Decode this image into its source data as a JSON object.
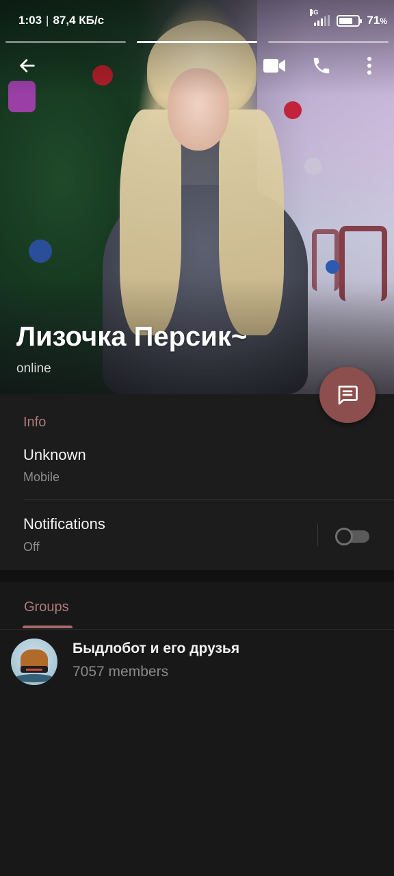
{
  "status_bar": {
    "time": "1:03",
    "separator": "|",
    "net_speed": "87,4 КБ/с",
    "network_type": "4G",
    "battery_level": 0.71,
    "battery_percent": "71",
    "battery_percent_sign": "%"
  },
  "stories": {
    "count": 3,
    "active_index": 1
  },
  "toolbar": {
    "back_icon": "arrow-left-icon",
    "video_icon": "video-camera-icon",
    "phone_icon": "phone-icon",
    "more_icon": "more-vertical-icon"
  },
  "profile": {
    "name": "Лизочка Персик~",
    "status": "online"
  },
  "fab": {
    "icon": "message-icon",
    "color": "#8d4f4d"
  },
  "info": {
    "section_title": "Info",
    "phone_value": "Unknown",
    "phone_label": "Mobile",
    "notifications_title": "Notifications",
    "notifications_value": "Off",
    "notifications_enabled": false
  },
  "groups": {
    "tab_label": "Groups",
    "items": [
      {
        "name": "Быдлобот и его друзья",
        "members": "7057 members"
      }
    ]
  },
  "colors": {
    "accent": "#b07a7a",
    "background": "#1c1c1c",
    "fab": "#8d4f4d"
  }
}
